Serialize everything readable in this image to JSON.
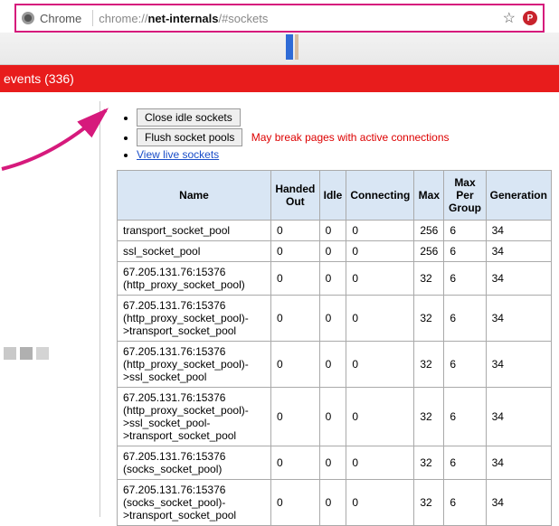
{
  "addrbar": {
    "site": "Chrome",
    "url_prefix": "chrome://",
    "url_bold": "net-internals",
    "url_suffix": "/#sockets"
  },
  "redbar": {
    "label": "events (336)"
  },
  "actions": {
    "close_idle": "Close idle sockets",
    "flush": "Flush socket pools",
    "flush_warn": "May break pages with active connections",
    "view_live": "View live sockets"
  },
  "table": {
    "headers": [
      "Name",
      "Handed Out",
      "Idle",
      "Connecting",
      "Max",
      "Max Per Group",
      "Generation"
    ],
    "rows": [
      [
        "transport_socket_pool",
        "0",
        "0",
        "0",
        "256",
        "6",
        "34"
      ],
      [
        "ssl_socket_pool",
        "0",
        "0",
        "0",
        "256",
        "6",
        "34"
      ],
      [
        "67.205.131.76:15376 (http_proxy_socket_pool)",
        "0",
        "0",
        "0",
        "32",
        "6",
        "34"
      ],
      [
        "67.205.131.76:15376 (http_proxy_socket_pool)->transport_socket_pool",
        "0",
        "0",
        "0",
        "32",
        "6",
        "34"
      ],
      [
        "67.205.131.76:15376 (http_proxy_socket_pool)->ssl_socket_pool",
        "0",
        "0",
        "0",
        "32",
        "6",
        "34"
      ],
      [
        "67.205.131.76:15376 (http_proxy_socket_pool)->ssl_socket_pool->transport_socket_pool",
        "0",
        "0",
        "0",
        "32",
        "6",
        "34"
      ],
      [
        "67.205.131.76:15376 (socks_socket_pool)",
        "0",
        "0",
        "0",
        "32",
        "6",
        "34"
      ],
      [
        "67.205.131.76:15376 (socks_socket_pool)->transport_socket_pool",
        "0",
        "0",
        "0",
        "32",
        "6",
        "34"
      ]
    ]
  }
}
